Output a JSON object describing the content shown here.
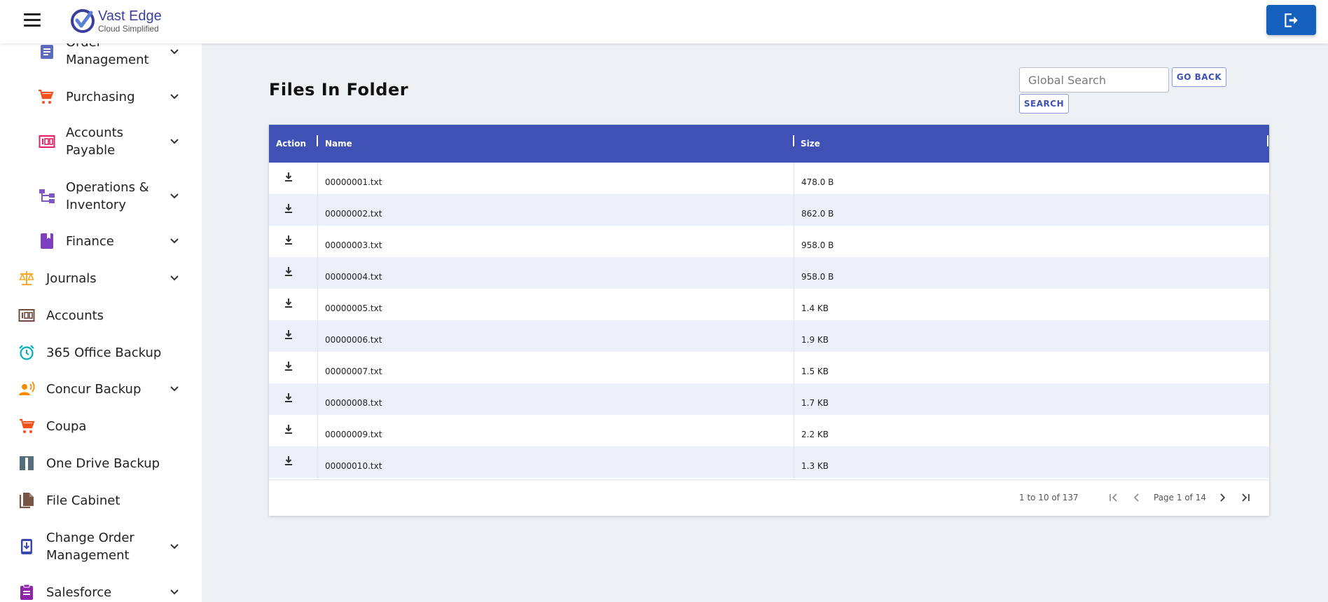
{
  "brand": {
    "name": "Vast Edge",
    "tagline": "Cloud Simplified",
    "accent": "#3f51b5"
  },
  "sidebar": {
    "items": [
      {
        "label_line1": "Order",
        "label_line2": "Management",
        "icon": "document-list-icon",
        "expandable": true
      },
      {
        "label": "Purchasing",
        "icon": "cart-icon",
        "expandable": true
      },
      {
        "label_line1": "Accounts",
        "label_line2": "Payable",
        "icon": "ledger-icon",
        "expandable": true
      },
      {
        "label_line1": "Operations &",
        "label_line2": "Inventory",
        "icon": "hierarchy-icon",
        "expandable": true
      },
      {
        "label": "Finance",
        "icon": "book-icon",
        "expandable": true
      },
      {
        "label": "Journals",
        "icon": "scale-icon",
        "expandable": true
      },
      {
        "label": "Accounts",
        "icon": "ledger-icon",
        "expandable": false
      },
      {
        "label": "365 Office Backup",
        "icon": "alarm-clock-icon",
        "expandable": false
      },
      {
        "label": "Concur Backup",
        "icon": "user-voice-icon",
        "expandable": true
      },
      {
        "label": "Coupa",
        "icon": "cart-icon",
        "expandable": false
      },
      {
        "label": "One Drive Backup",
        "icon": "archive-icon",
        "expandable": false
      },
      {
        "label": "File Cabinet",
        "icon": "file-copy-icon",
        "expandable": false
      },
      {
        "label_line1": "Change Order",
        "label_line2": "Management",
        "icon": "phone-download-icon",
        "expandable": true
      },
      {
        "label": "Salesforce",
        "icon": "clipboard-icon",
        "expandable": true
      }
    ]
  },
  "main": {
    "title": "Files In Folder",
    "search": {
      "placeholder": "Global Search",
      "value": ""
    },
    "go_back_label": "GO BACK",
    "search_label": "SEARCH"
  },
  "table": {
    "columns": [
      "Action",
      "Name",
      "Size"
    ],
    "rows": [
      {
        "name": "00000001.txt",
        "size": "478.0 B"
      },
      {
        "name": "00000002.txt",
        "size": "862.0 B"
      },
      {
        "name": "00000003.txt",
        "size": "958.0 B"
      },
      {
        "name": "00000004.txt",
        "size": "958.0 B"
      },
      {
        "name": "00000005.txt",
        "size": "1.4 KB"
      },
      {
        "name": "00000006.txt",
        "size": "1.9 KB"
      },
      {
        "name": "00000007.txt",
        "size": "1.5 KB"
      },
      {
        "name": "00000008.txt",
        "size": "1.7 KB"
      },
      {
        "name": "00000009.txt",
        "size": "2.2 KB"
      },
      {
        "name": "00000010.txt",
        "size": "1.3 KB"
      }
    ],
    "pagination": {
      "summary": "1 to 10 of 137",
      "page_text": "Page 1 of 14"
    }
  }
}
